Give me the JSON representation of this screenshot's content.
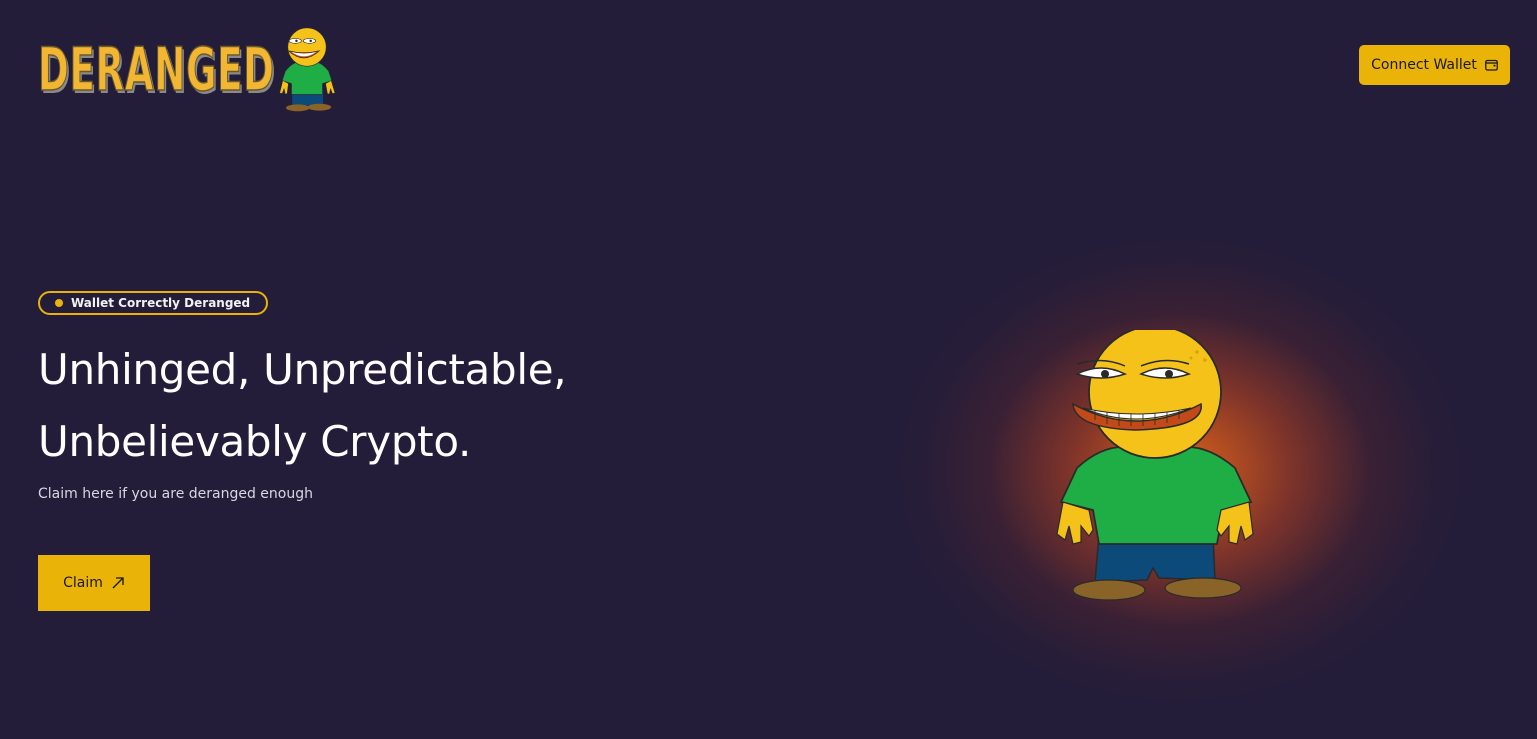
{
  "header": {
    "logo_text": "DERANGED",
    "logo_icon": "mascot-icon",
    "connect_label": "Connect Wallet",
    "connect_icon": "wallet-icon"
  },
  "hero": {
    "badge": "Wallet Correctly Deranged",
    "headline_line1": "Unhinged, Unpredictable,",
    "headline_line2": "Unbelievably Crypto.",
    "subtext": "Claim here if you are deranged enough",
    "claim_label": "Claim",
    "claim_icon": "arrow-up-right-icon",
    "image_icon": "mascot-icon"
  },
  "colors": {
    "background": "#241d39",
    "accent": "#eab308",
    "glow": "#ff6e14"
  }
}
